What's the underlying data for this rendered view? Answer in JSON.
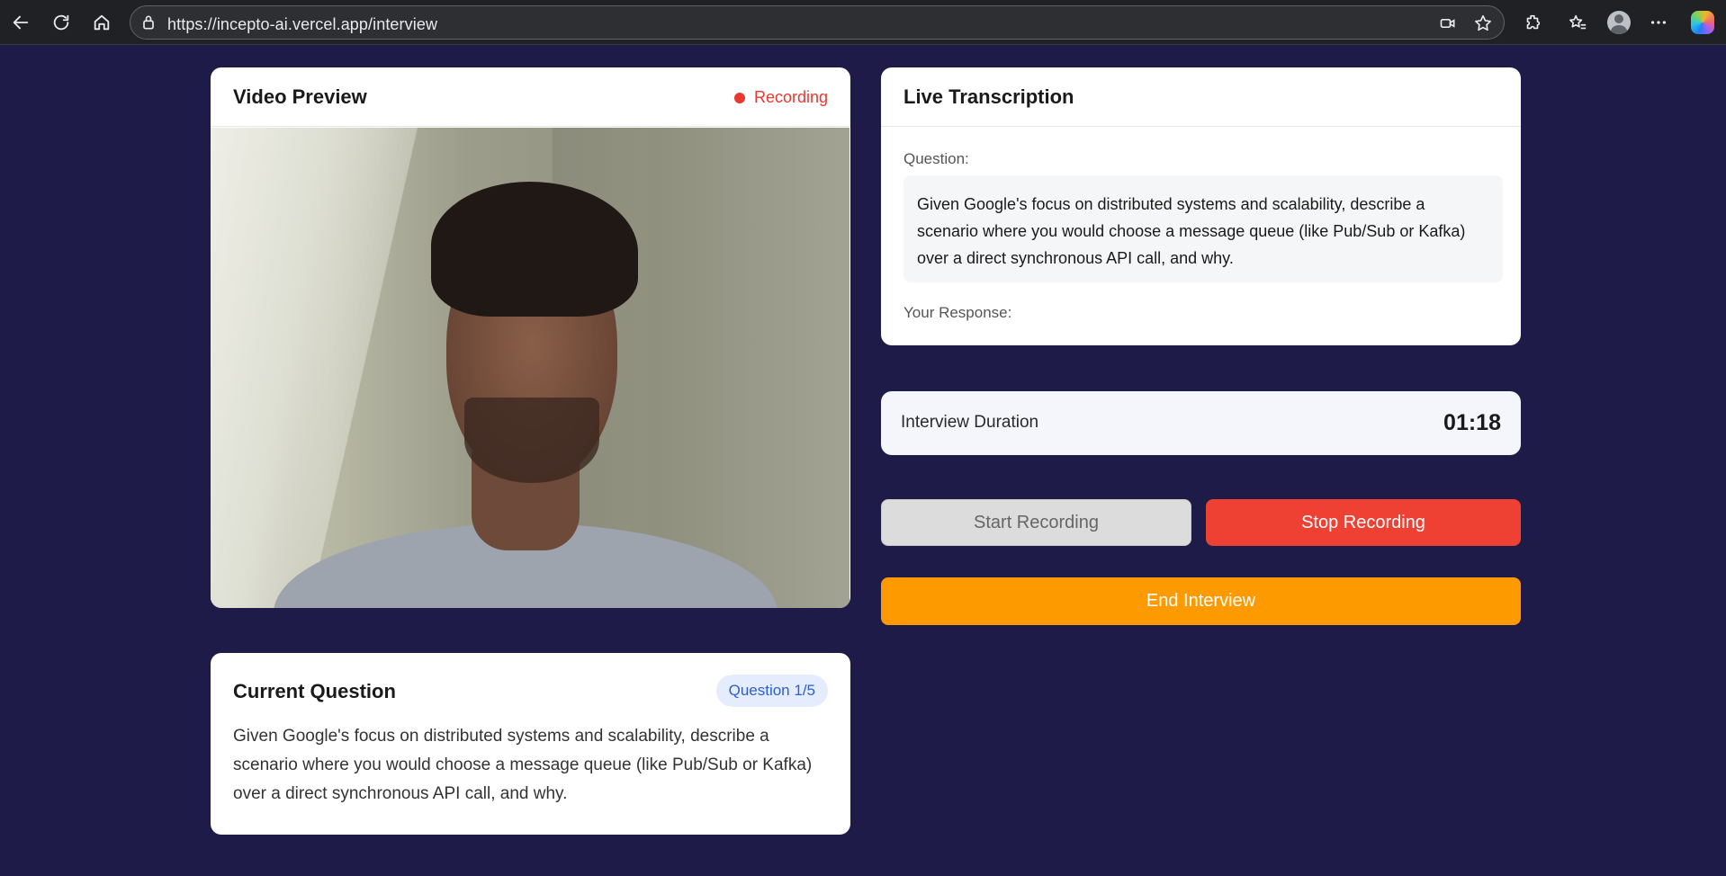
{
  "browser": {
    "url": "https://incepto-ai.vercel.app/interview"
  },
  "video_card": {
    "title": "Video Preview",
    "status": "Recording",
    "status_color": "#e8382f"
  },
  "transcription": {
    "title": "Live Transcription",
    "question_label": "Question:",
    "question_text": "Given Google's focus on distributed systems and scalability, describe a scenario where you would choose a message queue (like Pub/Sub or Kafka) over a direct synchronous API call, and why.",
    "response_label": "Your Response:",
    "response_text": ""
  },
  "duration": {
    "label": "Interview Duration",
    "value": "01:18"
  },
  "controls": {
    "start_label": "Start Recording",
    "stop_label": "Stop Recording",
    "end_label": "End Interview",
    "stop_color": "#ef4034",
    "end_color": "#fd9a00"
  },
  "current_question": {
    "title": "Current Question",
    "badge": "Question 1/5",
    "text": "Given Google's focus on distributed systems and scalability, describe a scenario where you would choose a message queue (like Pub/Sub or Kafka) over a direct synchronous API call, and why."
  },
  "theme": {
    "background": "#1f1b48"
  }
}
